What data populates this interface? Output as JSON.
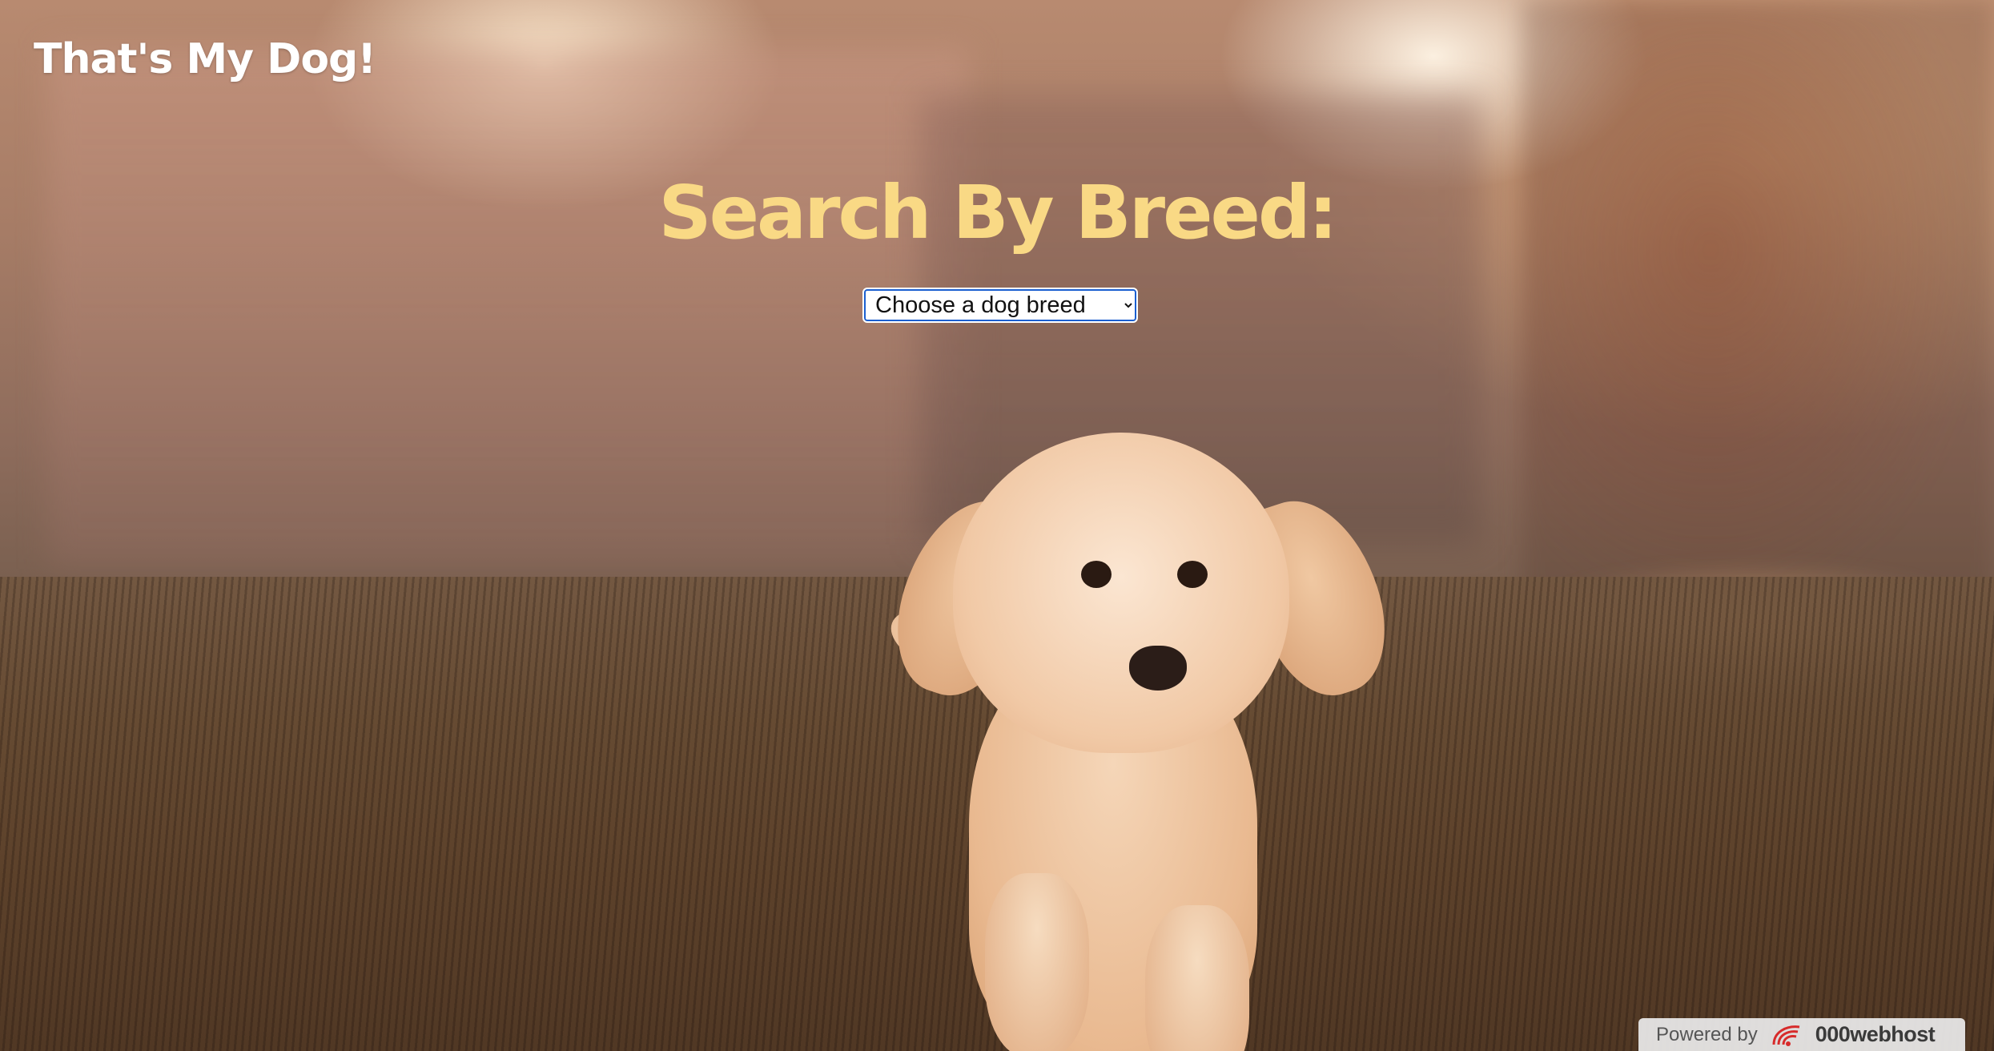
{
  "site": {
    "title": "That's My Dog!"
  },
  "search": {
    "heading": "Search By Breed:",
    "breed_select": {
      "selected": "Choose a dog breed",
      "options": [
        "Choose a dog breed"
      ]
    }
  },
  "footer_badge": {
    "powered_label": "Powered by",
    "brand": "000webhost",
    "logo_icon": "000webhost-logo-icon"
  },
  "background": {
    "image": "golden-retriever-puppy-running-on-grass-photo"
  },
  "colors": {
    "heading": "#f9d985",
    "title": "#ffffff",
    "select_border": "#1a5fd0",
    "badge_bg": "#ebebeb",
    "logo_red": "#d72b2b"
  }
}
